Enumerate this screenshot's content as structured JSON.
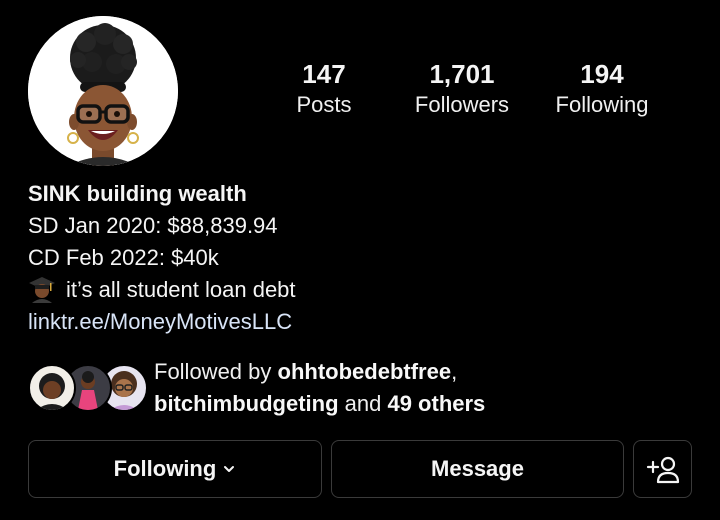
{
  "profile": {
    "stats": [
      {
        "value": "147",
        "label": "Posts"
      },
      {
        "value": "1,701",
        "label": "Followers"
      },
      {
        "value": "194",
        "label": "Following"
      }
    ],
    "bio": {
      "name": "SINK building wealth",
      "lines": [
        "SD Jan 2020: $88,839.94",
        "CD Feb 2022: $40k",
        "it’s all student loan debt"
      ],
      "emoji": "graduate-emoji",
      "link": "linktr.ee/MoneyMotivesLLC"
    },
    "followed_by": {
      "prefix": "Followed by ",
      "user1": "ohhtobedebtfree",
      "sep": ",",
      "user2": "bitchimbudgeting",
      "and_text": " and ",
      "others": "49 others"
    },
    "buttons": {
      "following_label": "Following",
      "message_label": "Message",
      "add_icon": "add-person-icon"
    }
  },
  "colors": {
    "background": "#000000",
    "text": "#f5f5f5",
    "link": "#d8e4f7",
    "button_border": "#3a3a3a"
  }
}
